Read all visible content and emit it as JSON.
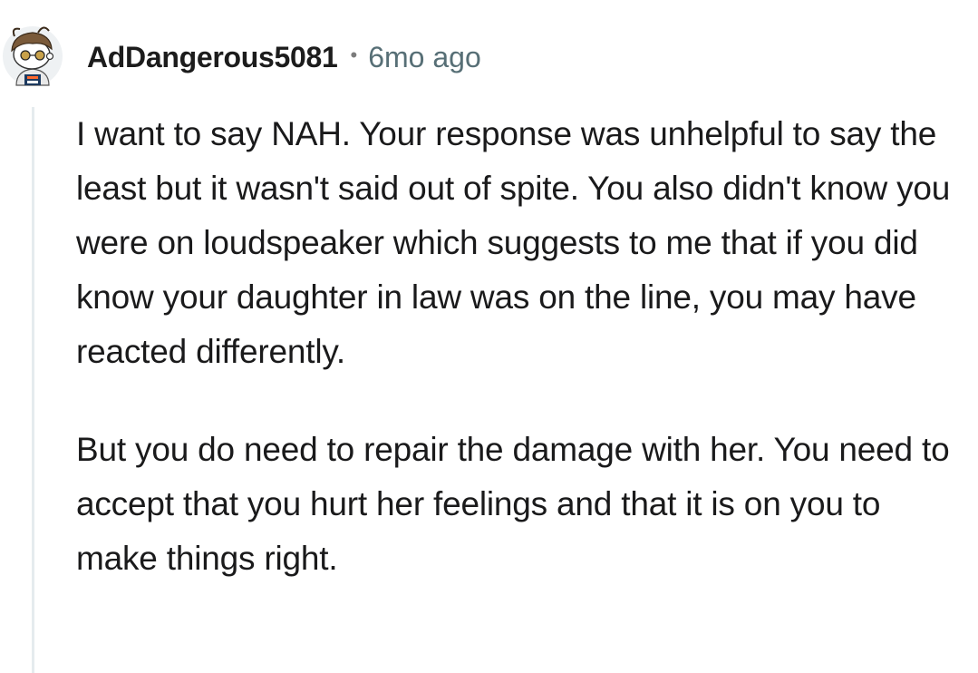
{
  "comment": {
    "author": "AdDangerous5081",
    "separator": "•",
    "time_ago": "6mo ago",
    "avatar_icon": "snoo-avatar-icon",
    "paragraphs": [
      "I want to say NAH. Your response was unhelpful to say the least but it wasn't said out of spite. You also didn't know you were on loudspeaker which suggests to me that if you did know your daughter in law was on the line, you may have reacted differently.",
      "But you do need to repair the damage with her. You need to accept that you hurt her feelings and that it is on you to make things right."
    ]
  },
  "colors": {
    "username": "#1c1c1c",
    "meta": "#576f76",
    "body": "#1a1a1b",
    "thread_line": "#e5ebee"
  }
}
